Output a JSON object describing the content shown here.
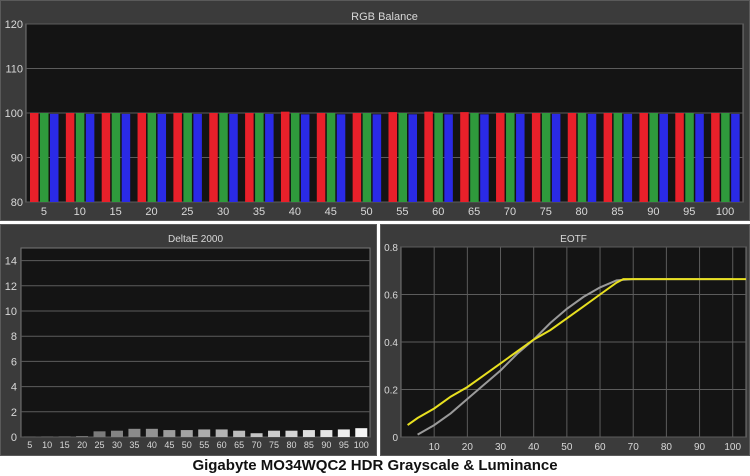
{
  "caption": "Gigabyte MO34WQC2 HDR Grayscale & Luminance",
  "colors": {
    "panel_bg": "#3b3b3b",
    "plot_bg": "#141414",
    "grid": "#5c5c5c",
    "text": "#d8d8d8",
    "red": "#e8202a",
    "green": "#2f9a3c",
    "blue": "#2a2ae6",
    "eotf_target": "#9a9a9a",
    "eotf_measured": "#e8e020"
  },
  "chart_data": [
    {
      "id": "rgb",
      "type": "bar",
      "title": "RGB Balance",
      "categories": [
        "5",
        "10",
        "15",
        "20",
        "25",
        "30",
        "35",
        "40",
        "45",
        "50",
        "55",
        "60",
        "65",
        "70",
        "75",
        "80",
        "85",
        "90",
        "95",
        "100"
      ],
      "series": [
        {
          "color": "#e8202a",
          "values": [
            100,
            100,
            100,
            100,
            100,
            100,
            100,
            100.3,
            100,
            100,
            100.2,
            100.3,
            100.2,
            100,
            100,
            100,
            100,
            100,
            100,
            100
          ]
        },
        {
          "color": "#2f9a3c",
          "values": [
            100,
            100,
            100,
            100,
            100,
            100,
            100,
            100,
            100,
            100,
            100,
            100,
            100,
            100,
            100,
            100,
            100,
            100,
            100,
            100
          ]
        },
        {
          "color": "#2a2ae6",
          "values": [
            99.8,
            99.8,
            99.8,
            99.8,
            99.8,
            99.8,
            99.8,
            99.7,
            99.7,
            99.7,
            99.7,
            99.7,
            99.7,
            99.8,
            99.8,
            99.8,
            99.8,
            99.8,
            99.8,
            99.8
          ]
        }
      ],
      "ylim": [
        80,
        120
      ],
      "yticks": [
        "80",
        "90",
        "100",
        "110",
        "120"
      ]
    },
    {
      "id": "deltae",
      "type": "bar",
      "title": "DeltaE 2000",
      "categories": [
        "5",
        "10",
        "15",
        "20",
        "25",
        "30",
        "35",
        "40",
        "45",
        "50",
        "55",
        "60",
        "65",
        "70",
        "75",
        "80",
        "85",
        "90",
        "95",
        "100"
      ],
      "values": [
        0.05,
        0.05,
        0.05,
        0.08,
        0.45,
        0.5,
        0.65,
        0.65,
        0.55,
        0.55,
        0.6,
        0.6,
        0.5,
        0.3,
        0.5,
        0.5,
        0.55,
        0.55,
        0.6,
        0.7
      ],
      "ylim": [
        0,
        15
      ],
      "yticks": [
        "0",
        "2",
        "4",
        "6",
        "8",
        "10",
        "12",
        "14"
      ]
    },
    {
      "id": "eotf",
      "type": "line",
      "title": "EOTF",
      "xlim": [
        0,
        104
      ],
      "ylim": [
        0,
        0.8
      ],
      "xticks": [
        "10",
        "20",
        "30",
        "40",
        "50",
        "60",
        "70",
        "80",
        "90",
        "100"
      ],
      "yticks": [
        "0",
        "0.2",
        "0.4",
        "0.6",
        "0.8"
      ],
      "series": [
        {
          "color": "#9a9a9a",
          "x": [
            5,
            10,
            15,
            20,
            25,
            30,
            35,
            40,
            45,
            50,
            55,
            60,
            65,
            70,
            75,
            80,
            85,
            90,
            95,
            100
          ],
          "y": [
            0.01,
            0.05,
            0.1,
            0.16,
            0.22,
            0.28,
            0.35,
            0.41,
            0.48,
            0.54,
            0.59,
            0.63,
            0.66,
            0.665,
            0.665,
            0.665,
            0.665,
            0.665,
            0.665,
            0.665
          ]
        },
        {
          "color": "#e8e020",
          "x": [
            2,
            5,
            10,
            15,
            20,
            25,
            30,
            35,
            40,
            45,
            50,
            55,
            60,
            65,
            67,
            70,
            75,
            80,
            85,
            90,
            95,
            100,
            104
          ],
          "y": [
            0.05,
            0.08,
            0.12,
            0.17,
            0.21,
            0.26,
            0.31,
            0.36,
            0.41,
            0.45,
            0.5,
            0.55,
            0.6,
            0.65,
            0.665,
            0.665,
            0.665,
            0.665,
            0.665,
            0.665,
            0.665,
            0.665,
            0.665
          ]
        }
      ]
    }
  ]
}
